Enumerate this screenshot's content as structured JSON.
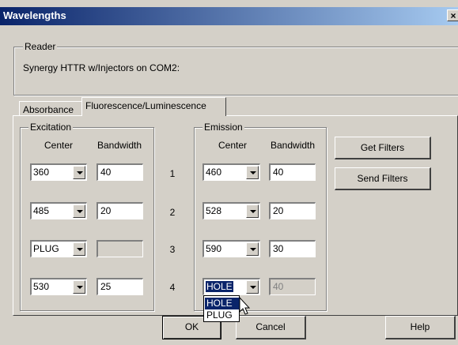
{
  "title": "Wavelengths",
  "close_glyph": "×",
  "reader": {
    "legend": "Reader",
    "text": "Synergy HTTR w/Injectors on COM2:"
  },
  "tabs": [
    {
      "label": "Absorbance"
    },
    {
      "label": "Fluorescence/Luminescence"
    }
  ],
  "excitation": {
    "legend": "Excitation",
    "center_header": "Center",
    "bandwidth_header": "Bandwidth",
    "rows": [
      {
        "center": "360",
        "bandwidth": "40"
      },
      {
        "center": "485",
        "bandwidth": "20"
      },
      {
        "center": "PLUG",
        "bandwidth": ""
      },
      {
        "center": "530",
        "bandwidth": "25"
      }
    ]
  },
  "row_numbers": [
    "1",
    "2",
    "3",
    "4"
  ],
  "emission": {
    "legend": "Emission",
    "center_header": "Center",
    "bandwidth_header": "Bandwidth",
    "rows": [
      {
        "center": "460",
        "bandwidth": "40"
      },
      {
        "center": "528",
        "bandwidth": "20"
      },
      {
        "center": "590",
        "bandwidth": "30"
      },
      {
        "center": "HOLE",
        "bandwidth": "40"
      }
    ]
  },
  "dropdown_options": [
    "HOLE",
    "PLUG"
  ],
  "buttons": {
    "get_filters": "Get Filters",
    "send_filters": "Send Filters",
    "ok": "OK",
    "cancel": "Cancel",
    "help": "Help"
  }
}
